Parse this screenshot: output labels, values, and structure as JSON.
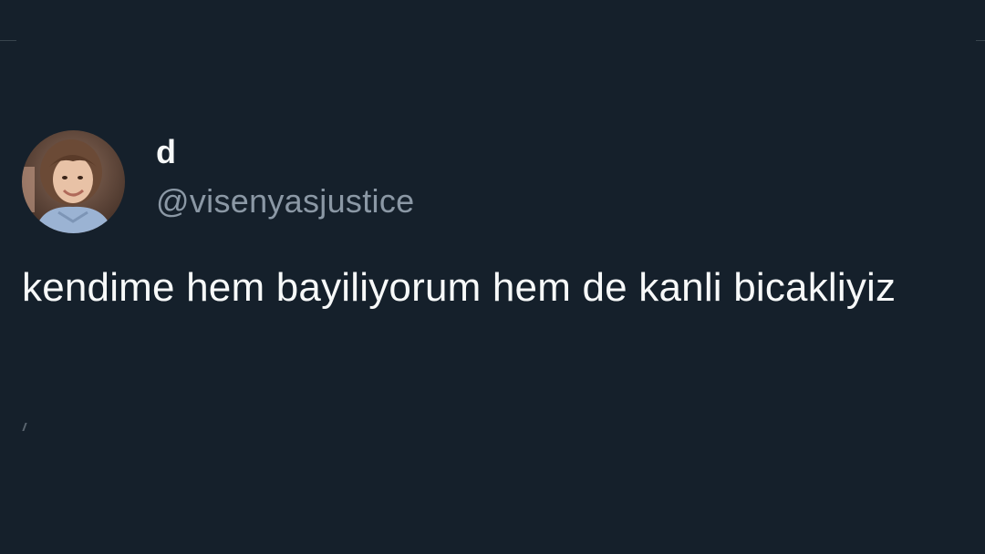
{
  "tweet": {
    "display_name": "d",
    "handle": "@visenyasjustice",
    "text": "kendime hem bayiliyorum hem de kanli bicakliyiz"
  },
  "colors": {
    "background": "#15202b",
    "text_primary": "#f7f9f9",
    "text_secondary": "#8b98a5",
    "divider": "#38444d"
  },
  "icons": {
    "avatar": "profile-photo-child"
  }
}
